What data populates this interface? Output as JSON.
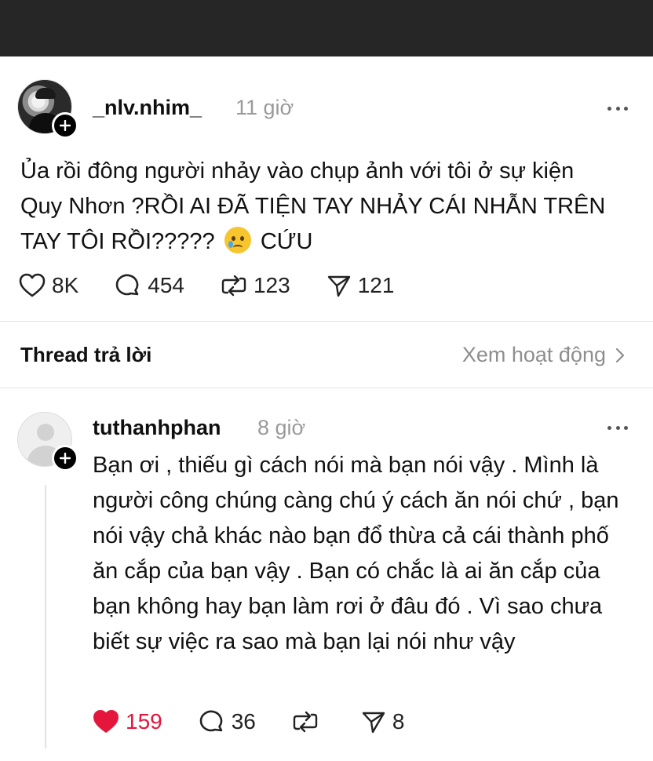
{
  "post": {
    "username": "_nlv.nhim_",
    "time": "11 giờ",
    "text_main": "Ủa rồi đông người nhảy vào chụp ảnh với tôi ở sự kiện Quy Nhơn ?RỒI AI ĐÃ TIỆN TAY NHẢY CÁI NHẪN TRÊN TAY TÔI RỒI?????",
    "text_end": "CỨU",
    "emoji": "face-holding-back-tears",
    "likes": "8K",
    "comments": "454",
    "reposts": "123",
    "shares": "121"
  },
  "thread": {
    "label": "Thread trả lời",
    "activity_link": "Xem hoạt động"
  },
  "reply": {
    "username": "tuthanhphan",
    "time": "8 giờ",
    "text": "Bạn ơi , thiếu gì cách nói mà bạn nói vậy . Mình là người công chúng càng chú ý cách ăn nói chứ , bạn nói vậy chả khác nào bạn đổ thừa cả cái thành phố ăn cắp của bạn vậy . Bạn có chắc là ai ăn cắp của bạn không hay bạn làm rơi ở đâu đó . Vì sao chưa biết sự việc ra sao mà bạn lại nói như vậy",
    "likes": "159",
    "liked": true,
    "comments": "36",
    "shares": "8"
  },
  "colors": {
    "topbar": "#262626",
    "like_active": "#e4163c",
    "muted": "#9a9a9a"
  }
}
